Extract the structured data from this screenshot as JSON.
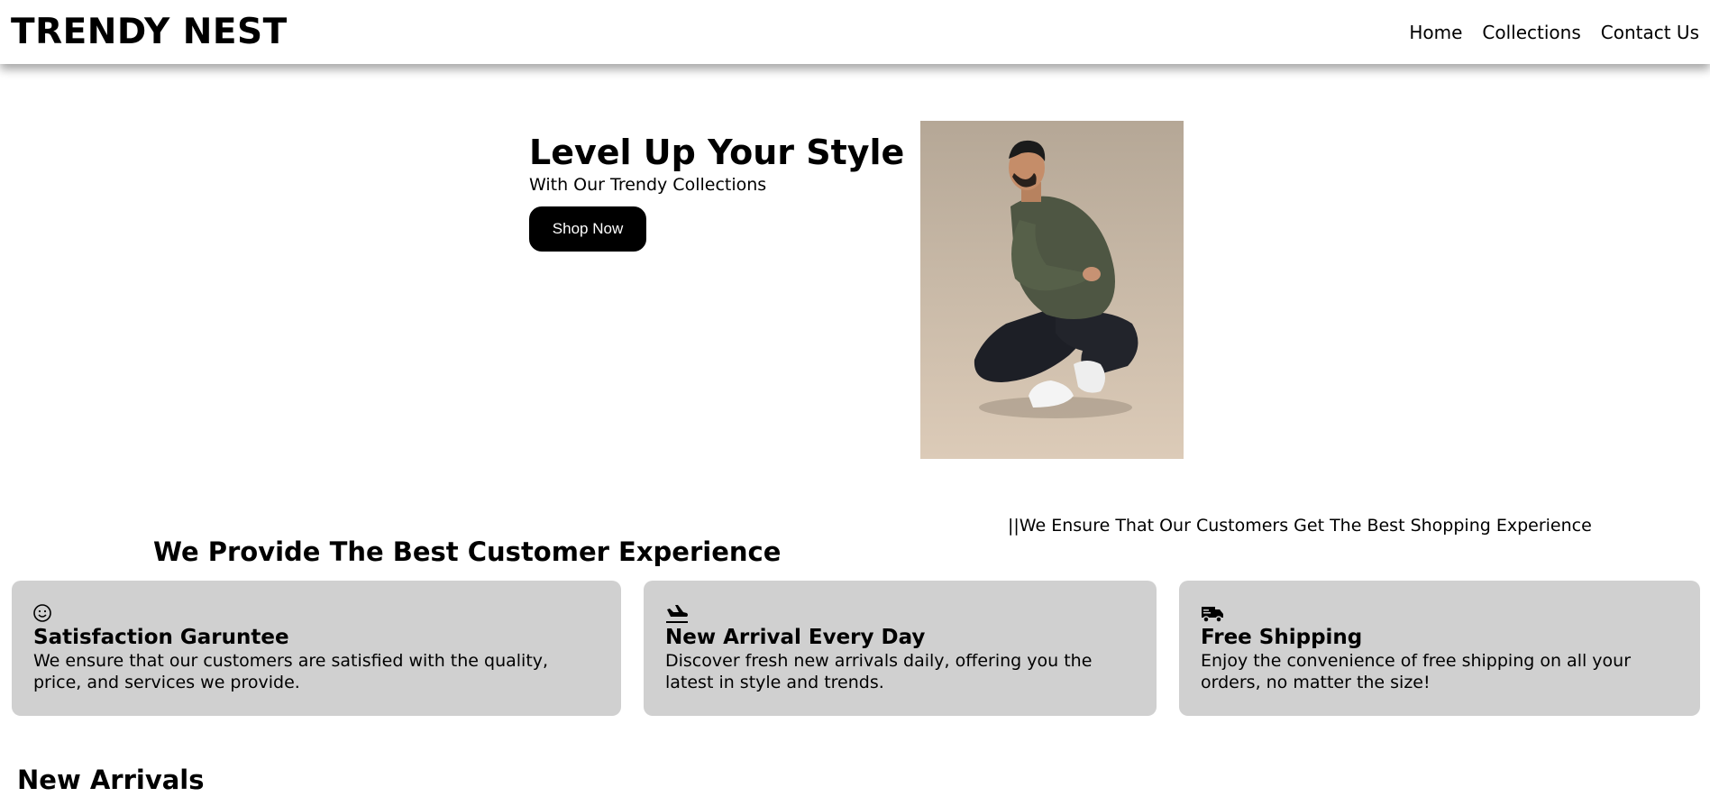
{
  "header": {
    "brand": "TRENDY NEST",
    "nav": [
      "Home",
      "Collections",
      "Contact Us"
    ]
  },
  "hero": {
    "title": "Level Up Your Style",
    "subtitle": "With Our Trendy Collections",
    "cta_label": "Shop Now"
  },
  "experience": {
    "title": "We Provide The Best Customer Experience",
    "tagline": "||We Ensure That Our Customers Get The Best Shopping Experience"
  },
  "features": [
    {
      "icon": "smiley-icon",
      "title": "Satisfaction Garuntee",
      "text": "We ensure that our customers are satisfied with the quality, price, and services we provide."
    },
    {
      "icon": "plane-arrival-icon",
      "title": "New Arrival Every Day",
      "text": "Discover fresh new arrivals daily, offering you the latest in style and trends."
    },
    {
      "icon": "truck-icon",
      "title": "Free Shipping",
      "text": "Enjoy the convenience of free shipping on all your orders, no matter the size!"
    }
  ],
  "new_arrivals": {
    "title": "New Arrivals"
  },
  "colors": {
    "accent": "#000000",
    "card_bg": "#d0d0d0",
    "photo_bg": "#c7b8a6"
  }
}
